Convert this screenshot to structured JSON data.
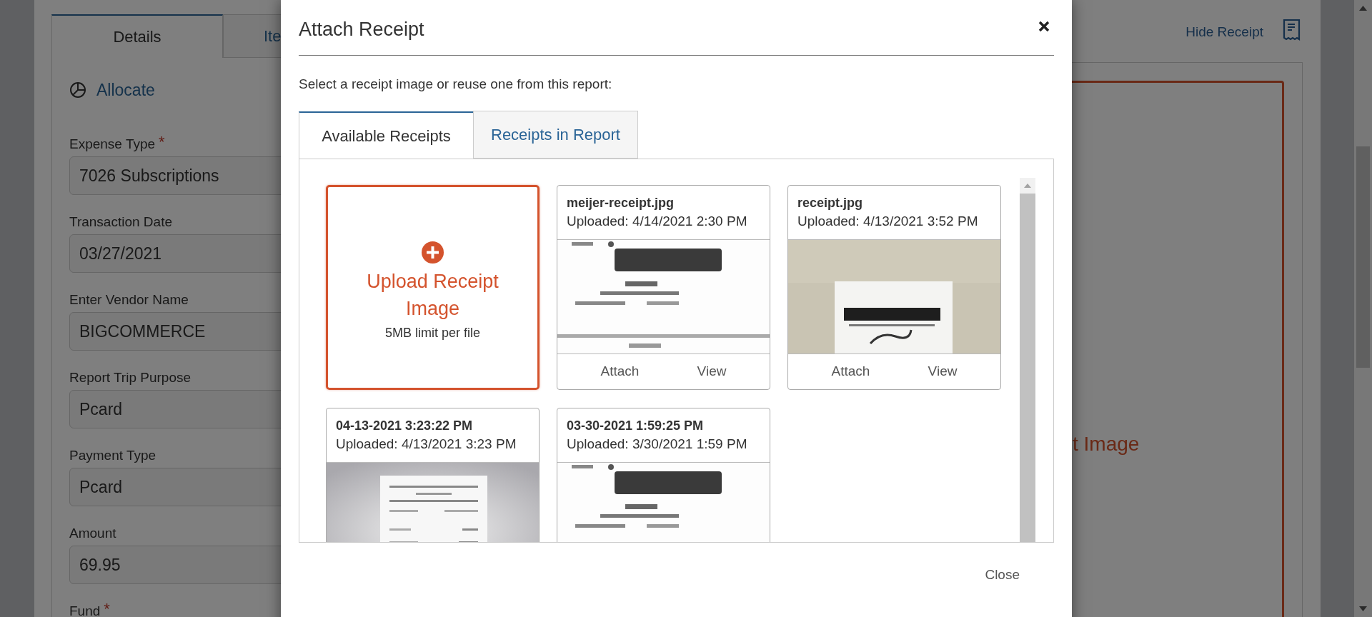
{
  "background_page": {
    "tabs": [
      {
        "label": "Details",
        "selected": true
      },
      {
        "label": "Ite",
        "selected": false
      }
    ],
    "allocate_link": "Allocate",
    "fields": [
      {
        "label": "Expense Type",
        "required_mark": "*",
        "value": "7026 Subscriptions"
      },
      {
        "label": "Transaction Date",
        "value": "03/27/2021"
      },
      {
        "label": "Enter Vendor Name",
        "value": "BIGCOMMERCE"
      },
      {
        "label": "Report Trip Purpose",
        "value": "Pcard"
      },
      {
        "label": "Payment Type",
        "value": "Pcard"
      },
      {
        "label": "Amount",
        "value": "69.95"
      },
      {
        "label": "Fund",
        "required_mark": "*"
      }
    ],
    "hide_receipt_link": "Hide Receipt",
    "receipt_panel_text": "t Image"
  },
  "dialog": {
    "title": "Attach Receipt",
    "instruction": "Select a receipt image or reuse one from this report:",
    "tabs": [
      {
        "label": "Available Receipts",
        "selected": true
      },
      {
        "label": "Receipts in Report",
        "selected": false
      }
    ],
    "upload_tile": {
      "title": "Upload Receipt Image",
      "note": "5MB limit per file"
    },
    "receipts": [
      {
        "name": "meijer-receipt.jpg",
        "uploaded": "Uploaded: 4/14/2021 2:30 PM",
        "actions": [
          "Attach",
          "View"
        ]
      },
      {
        "name": "receipt.jpg",
        "uploaded": "Uploaded: 4/13/2021 3:52 PM",
        "actions": [
          "Attach",
          "View"
        ]
      },
      {
        "name": "04-13-2021 3:23:22 PM",
        "uploaded": "Uploaded: 4/13/2021 3:23 PM"
      },
      {
        "name": "03-30-2021 1:59:25 PM",
        "uploaded": "Uploaded: 3/30/2021 1:59 PM"
      }
    ],
    "footer_button": "Close"
  }
}
